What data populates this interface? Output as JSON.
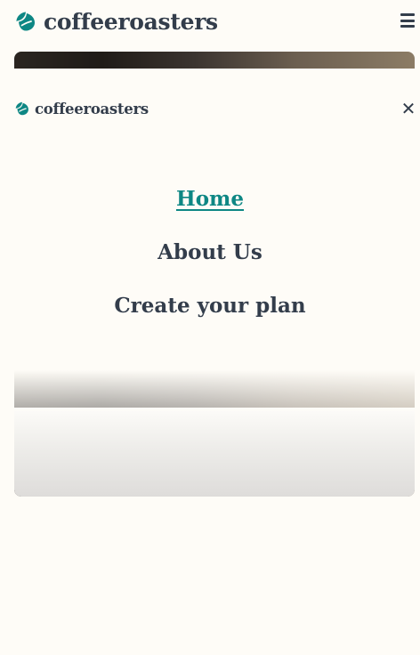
{
  "brand": {
    "name": "coffeeroasters",
    "accent_color": "#0E8784",
    "text_color": "#333D4B"
  },
  "header": {
    "menu_icon": "hamburger-icon"
  },
  "mobile_nav": {
    "close_icon": "close-icon",
    "items": [
      {
        "label": "Home",
        "active": true
      },
      {
        "label": "About Us",
        "active": false
      },
      {
        "label": "Create your plan",
        "active": false
      }
    ]
  }
}
